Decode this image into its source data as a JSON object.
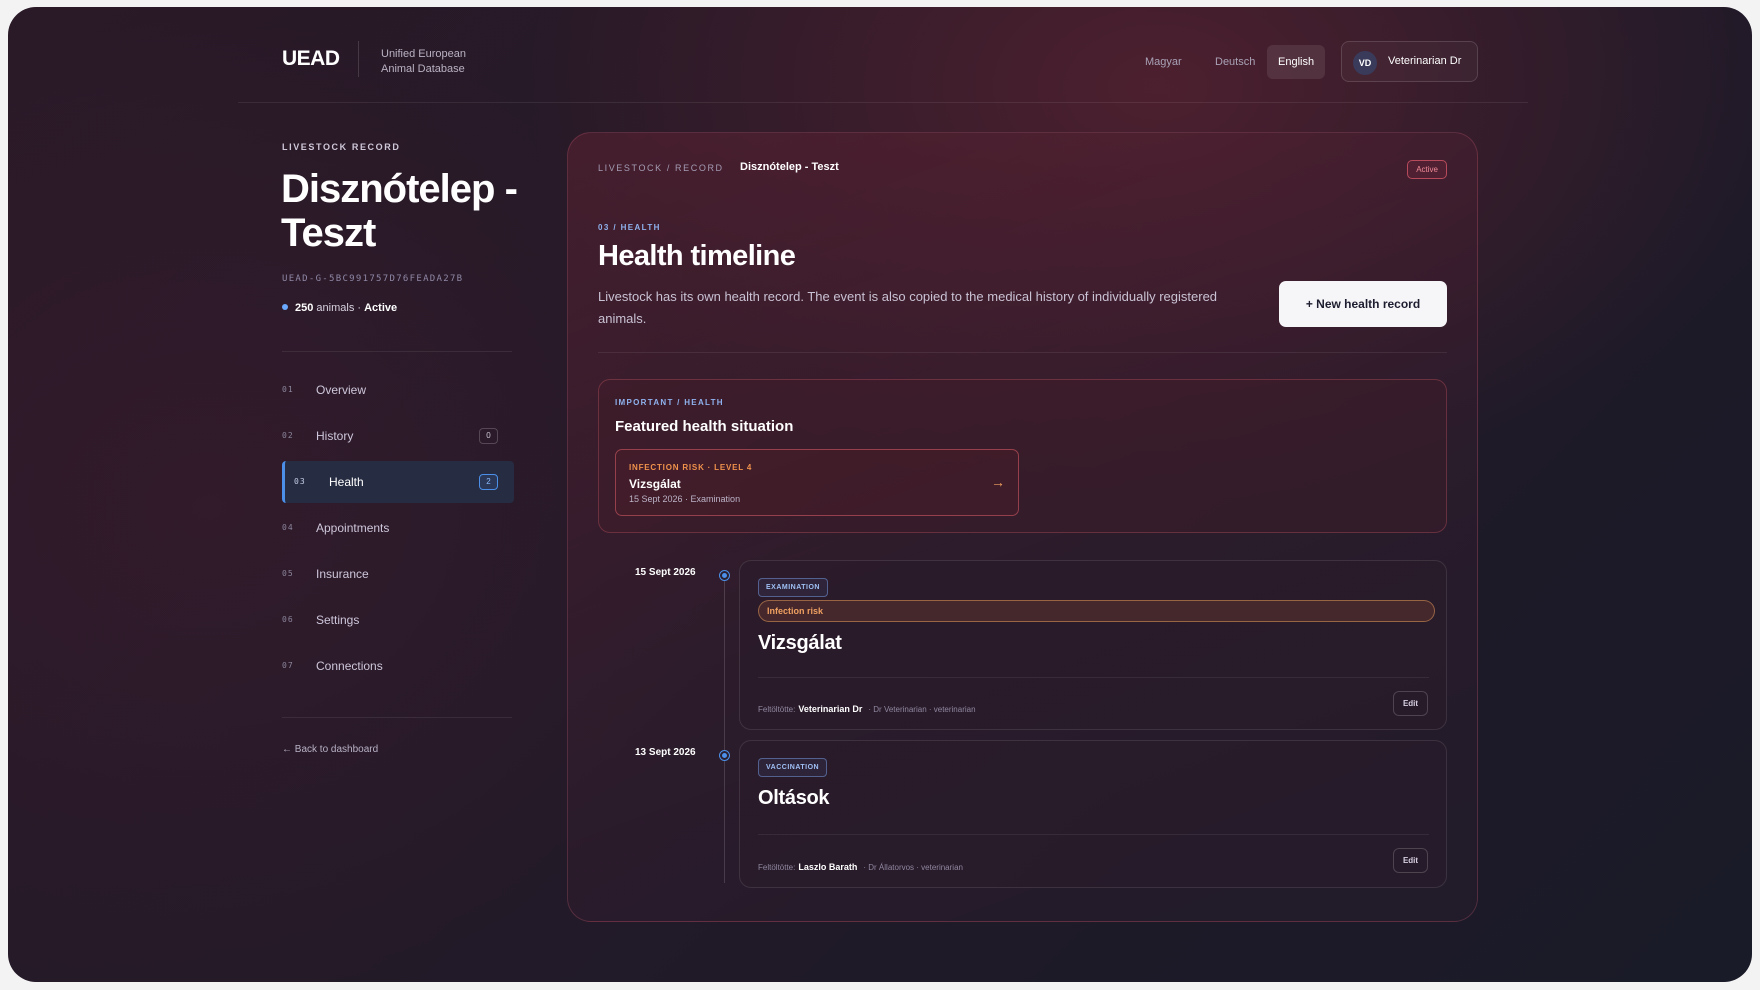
{
  "header": {
    "logo": "UEAD",
    "logo_sub_line1": "Unified European",
    "logo_sub_line2": "Animal Database",
    "languages": [
      "Magyar",
      "Deutsch",
      "English"
    ],
    "active_language": "English",
    "user": {
      "initials": "VD",
      "name": "Veterinarian Dr"
    }
  },
  "sidebar": {
    "eyebrow": "LIVESTOCK RECORD",
    "title": "Disznótelep - Teszt",
    "record_id": "UEAD-G-5BC991757D76FEADA27B",
    "animal_count": "250",
    "animal_label": "animals ·",
    "status": "Active",
    "nav": [
      {
        "num": "01",
        "label": "Overview",
        "badge": null
      },
      {
        "num": "02",
        "label": "History",
        "badge": "0"
      },
      {
        "num": "03",
        "label": "Health",
        "badge": "2"
      },
      {
        "num": "04",
        "label": "Appointments",
        "badge": null
      },
      {
        "num": "05",
        "label": "Insurance",
        "badge": null
      },
      {
        "num": "06",
        "label": "Settings",
        "badge": null
      },
      {
        "num": "07",
        "label": "Connections",
        "badge": null
      }
    ],
    "back_link": "← Back to dashboard"
  },
  "main": {
    "breadcrumb": "LIVESTOCK / RECORD",
    "breadcrumb_current": "Disznótelep - Teszt",
    "status_pill": "Active",
    "section_eyebrow": "03 / HEALTH",
    "section_title": "Health timeline",
    "section_desc": "Livestock has its own health record. The event is also copied to the medical history of individually registered animals.",
    "new_button": "+ New health record",
    "featured": {
      "eyebrow": "IMPORTANT / HEALTH",
      "title": "Featured health situation",
      "risk_label": "INFECTION RISK · LEVEL 4",
      "risk_name": "Vizsgálat",
      "risk_meta": "15 Sept 2026 · Examination"
    },
    "events": [
      {
        "date": "15 Sept 2026",
        "tag": "EXAMINATION",
        "risk": "Infection risk",
        "title": "Vizsgálat",
        "uploaded_label": "Feltöltötte:",
        "uploader": "Veterinarian Dr",
        "uploader_role": "· Dr Veterinarian · veterinarian",
        "edit": "Edit"
      },
      {
        "date": "13 Sept 2026",
        "tag": "VACCINATION",
        "risk": null,
        "title": "Oltások",
        "uploaded_label": "Feltöltötte:",
        "uploader": "Laszlo Barath",
        "uploader_role": "· Dr Állatorvos · veterinarian",
        "edit": "Edit"
      }
    ]
  },
  "colors": {
    "accent_blue": "#4b8fe8",
    "risk_orange": "#f0924c",
    "active_red": "#f08a98"
  }
}
